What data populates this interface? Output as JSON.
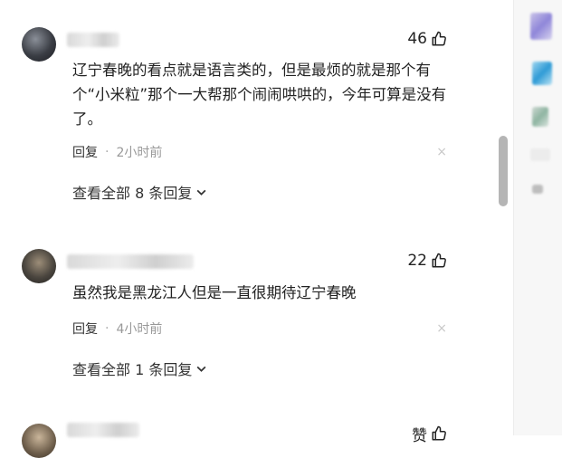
{
  "comments": [
    {
      "likes": "46",
      "text": "辽宁春晚的看点就是语言类的，但是最烦的就是那个有个“小米粒”那个一大帮那个闹闹哄哄的，今年可算是没有了。",
      "reply_label": "回复",
      "dot": "·",
      "time": "2小时前",
      "close": "×",
      "view_all": "查看全部 8 条回复"
    },
    {
      "likes": "22",
      "text": "虽然我是黑龙江人但是一直很期待辽宁春晚",
      "reply_label": "回复",
      "dot": "·",
      "time": "4小时前",
      "close": "×",
      "view_all": "查看全部 1 条回复"
    },
    {
      "likes": "赞"
    }
  ],
  "colors": {
    "accent_thumb": "#b5b5b5",
    "text": "#222222",
    "muted": "#999999"
  },
  "icons": {
    "like": "thumbs-up-icon",
    "close": "close-icon",
    "expand": "chevron-down-icon"
  }
}
